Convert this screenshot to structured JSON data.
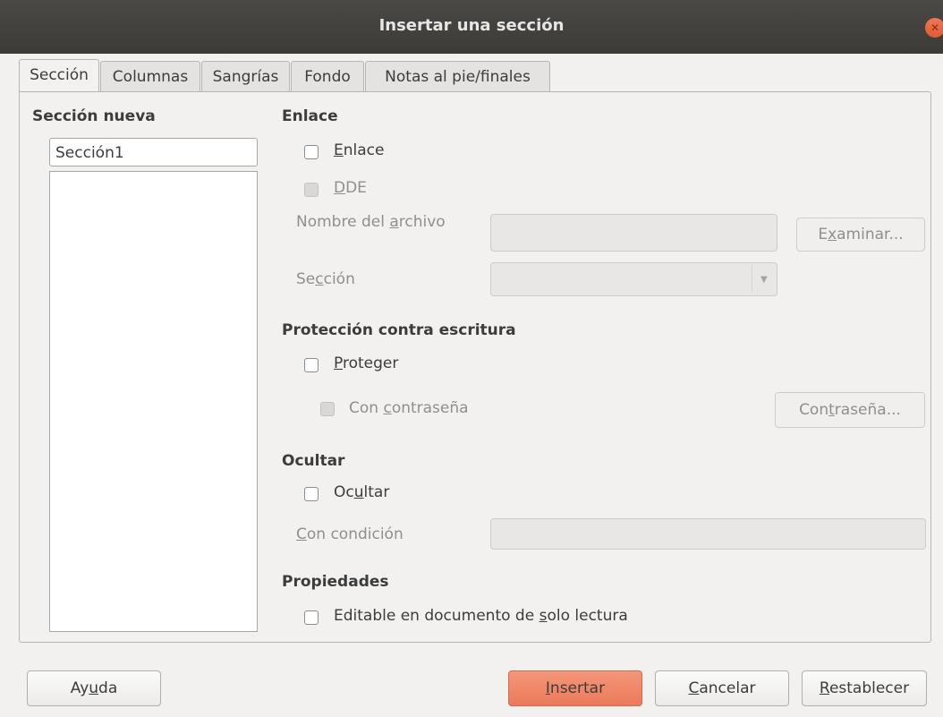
{
  "window": {
    "title": "Insertar una sección"
  },
  "tabs": [
    {
      "label": "Sección"
    },
    {
      "label": "Columnas"
    },
    {
      "label": "Sangrías"
    },
    {
      "label": "Fondo"
    },
    {
      "label": "Notas al pie/finales"
    }
  ],
  "new_section": {
    "heading": "Sección nueva",
    "name_value": "Sección1"
  },
  "link": {
    "heading": "Enlace",
    "link_checkbox": {
      "pre": "",
      "ul": "E",
      "post": "nlace"
    },
    "dde_checkbox": {
      "pre": "",
      "ul": "D",
      "post": "DE"
    },
    "filename_label": {
      "pre": "Nombre del ",
      "ul": "a",
      "post": "rchivo"
    },
    "browse_button": {
      "pre": "E",
      "ul": "x",
      "post": "aminar..."
    },
    "section_label": {
      "pre": "Se",
      "ul": "c",
      "post": "ción"
    }
  },
  "write_protection": {
    "heading": "Protección contra escritura",
    "protect_checkbox": {
      "pre": "",
      "ul": "P",
      "post": "roteger"
    },
    "password_checkbox": {
      "pre": "Con ",
      "ul": "c",
      "post": "ontraseña"
    },
    "password_button": {
      "pre": "Con",
      "ul": "t",
      "post": "raseña..."
    }
  },
  "hide": {
    "heading": "Ocultar",
    "hide_checkbox": {
      "pre": "Oc",
      "ul": "u",
      "post": "ltar"
    },
    "condition_label": {
      "pre": "",
      "ul": "C",
      "post": "on condición"
    }
  },
  "properties": {
    "heading": "Propiedades",
    "editable_checkbox": {
      "pre": "Editable en documento de ",
      "ul": "s",
      "post": "olo lectura"
    }
  },
  "buttons": {
    "help": {
      "pre": "Ay",
      "ul": "u",
      "post": "da"
    },
    "insert": {
      "pre": "",
      "ul": "I",
      "post": "nsertar"
    },
    "cancel": {
      "pre": "",
      "ul": "C",
      "post": "ancelar"
    },
    "reset": {
      "pre": "",
      "ul": "R",
      "post": "establecer"
    }
  },
  "colors": {
    "titlebar": "#3c3b37",
    "accent": "#ea7a5a",
    "background": "#f2f1f0"
  }
}
